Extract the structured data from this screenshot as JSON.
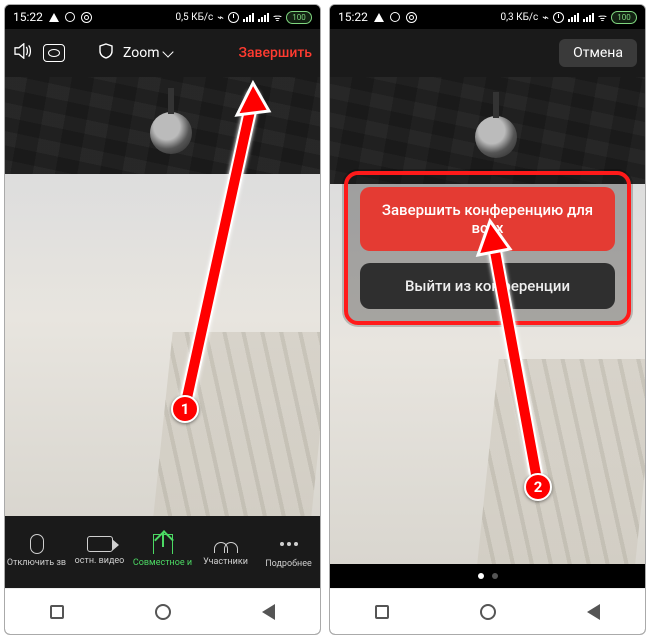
{
  "status": {
    "time": "15:22",
    "data_rate_left": "0,5 КБ/с",
    "data_rate_right": "0,3 КБ/с",
    "battery": "100"
  },
  "zoom": {
    "title": "Zoom",
    "end_label": "Завершить",
    "cancel_label": "Отмена"
  },
  "toolbar": {
    "mute": "Отключить зв",
    "video": "остн. видео",
    "share": "Совместное и",
    "participants": "Участники",
    "more": "Подробнее"
  },
  "popup": {
    "end_all": "Завершить конференцию для всех",
    "leave": "Выйти из конференции"
  },
  "badges": {
    "one": "1",
    "two": "2"
  }
}
